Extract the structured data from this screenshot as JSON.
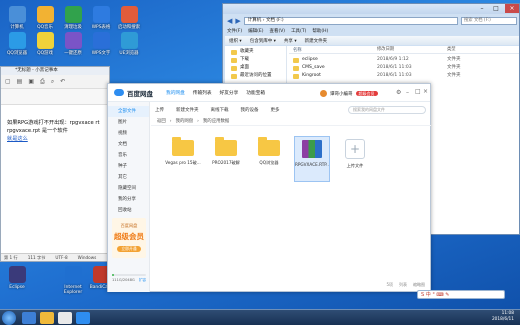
{
  "desktop": {
    "icons": [
      {
        "label": "计算机"
      },
      {
        "label": "QQ音乐"
      },
      {
        "label": "清理垃圾"
      },
      {
        "label": "WPS表格"
      },
      {
        "label": "启动和搜索"
      },
      {
        "label": "QQ浏览器"
      },
      {
        "label": "QQ游戏"
      },
      {
        "label": "一键还原"
      },
      {
        "label": "WPS文字"
      },
      {
        "label": "UE浏览器"
      },
      {
        "label": "Eclipse"
      },
      {
        "label": "Internet Explorer"
      },
      {
        "label": "BandiCam"
      }
    ]
  },
  "explorer": {
    "address": "计算机 › 文档 (F:)",
    "search_placeholder": "搜索 文档 (F:)",
    "menu": [
      "文件(F)",
      "编辑(E)",
      "查看(V)",
      "工具(T)",
      "帮助(H)"
    ],
    "toolbar": [
      "组织 ▾",
      "包含到库中 ▾",
      "共享 ▾",
      "新建文件夹"
    ],
    "nav": [
      "收藏夹",
      "下载",
      "桌面",
      "最近访问的位置"
    ],
    "columns": [
      "名称",
      "修改日期",
      "类型"
    ],
    "rows": [
      {
        "name": "eclipse",
        "date": "2018/6/9 1:12",
        "type": "文件夹"
      },
      {
        "name": "CMS_save",
        "date": "2018/6/1 11:03",
        "type": "文件夹"
      },
      {
        "name": "Kingroot",
        "date": "2018/6/1 11:03",
        "type": "文件夹"
      }
    ]
  },
  "notepad": {
    "title": "*无标题 - 小黑记事本",
    "lines": [
      "如果RPG游戏打不开出现：rpgvxace rt",
      "rpgvxace.rpt 是一个软件"
    ],
    "link": "就是这么",
    "status": [
      "第 1 行",
      "111 字节",
      "UTF-8",
      "Windows"
    ]
  },
  "baidu": {
    "brand": "百度网盘",
    "tabs": [
      {
        "label": "我的网盘",
        "active": true
      },
      {
        "label": "传输列表"
      },
      {
        "label": "好友分享"
      },
      {
        "label": "功能宝箱"
      }
    ],
    "user": "谭哥小编哥",
    "vip_badge": "超级会员",
    "sidebar": [
      {
        "label": "全部文件",
        "active": true
      },
      {
        "label": "图片"
      },
      {
        "label": "视频"
      },
      {
        "label": "文档"
      },
      {
        "label": "音乐"
      },
      {
        "label": "种子"
      },
      {
        "label": "其它"
      },
      {
        "label": "隐藏空间"
      },
      {
        "label": "我的分享"
      },
      {
        "label": "回收站"
      }
    ],
    "promo": {
      "top": "百度网盘",
      "main": "超级会员",
      "cta": "立即开通"
    },
    "quota": {
      "used_label": "111G/2048G",
      "expand": "扩容",
      "fraction": 0.05
    },
    "toolbar": [
      "上传",
      "新建文件夹",
      "离线下载",
      "我的设备",
      "更多"
    ],
    "search_placeholder": "搜索我的网盘文件",
    "breadcrumb": [
      "返回",
      "我的网盘",
      "我的应用数据"
    ],
    "files": [
      {
        "label": "Vegas pro 15破...",
        "kind": "folder"
      },
      {
        "label": "PRO2017破解",
        "kind": "folder"
      },
      {
        "label": "QQ浏览器",
        "kind": "folder"
      },
      {
        "label": "RPGVXACE.RTP...",
        "kind": "rar",
        "selected": true
      },
      {
        "label": "上传文件",
        "kind": "upload"
      }
    ],
    "footer": [
      "5项",
      "列表",
      "缩略图"
    ]
  },
  "ime": "S 中 ° ⌨ ✎",
  "clock": {
    "time": "11:08",
    "date": "2018/6/11"
  }
}
